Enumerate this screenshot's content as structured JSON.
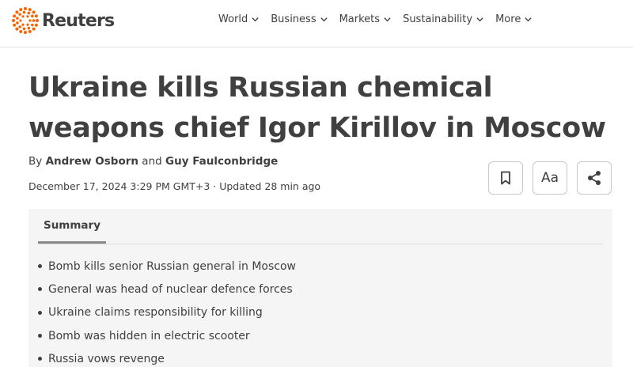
{
  "brand": {
    "name": "Reuters",
    "accent": "#fa6400",
    "text_color": "#404040"
  },
  "nav": {
    "items": [
      {
        "label": "World"
      },
      {
        "label": "Business"
      },
      {
        "label": "Markets"
      },
      {
        "label": "Sustainability"
      },
      {
        "label": "More"
      }
    ]
  },
  "article": {
    "title": "Ukraine kills Russian chemical weapons chief Igor Kirillov in Moscow",
    "byline": {
      "prefix": "By",
      "author1": "Andrew Osborn",
      "conjunction": "and",
      "author2": "Guy Faulconbridge"
    },
    "dateline": "December 17, 2024 3:29 PM GMT+3 · Updated 28 min ago",
    "tools": {
      "bookmark_icon": "bookmark-icon",
      "font_label": "Aa",
      "share_icon": "share-icon"
    }
  },
  "summary": {
    "tab_label": "Summary",
    "bullets": [
      "Bomb kills senior Russian general in Moscow",
      "General was head of nuclear defence forces",
      "Ukraine claims responsibility for killing",
      "Bomb was hidden in electric scooter",
      "Russia vows revenge"
    ]
  }
}
